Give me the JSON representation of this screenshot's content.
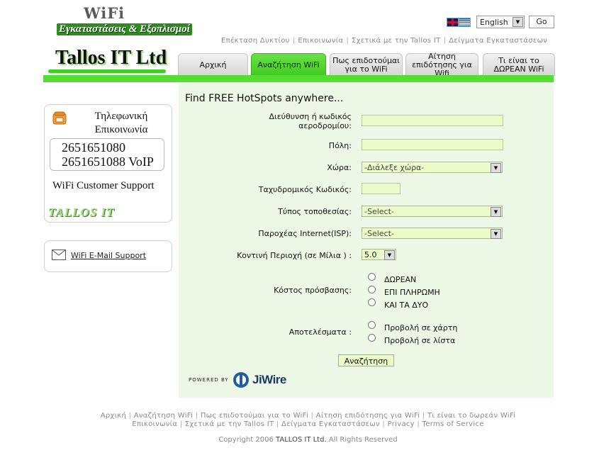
{
  "logo": {
    "wifi": "WiFi",
    "subtitle": "Εγκαταστάσεις & Εξοπλισμοί",
    "company": "Tallos IT Ltd"
  },
  "language": {
    "selected": "English",
    "go_label": "Go"
  },
  "top_links": [
    "Επέκταση Δυκτίου",
    "Επικοινωνία",
    "Σχετικά με την Tallos IT",
    "Δείγματα Εγκαταστάσεων"
  ],
  "tabs": [
    {
      "label": "Αρχική",
      "active": false
    },
    {
      "label": "Αναζήτηση  WiFi",
      "active": true
    },
    {
      "label": "Πως επιδοτούμαι για το WiFi",
      "active": false
    },
    {
      "label": "Αίτηση επιδότησης για Wifi",
      "active": false
    },
    {
      "label": "Τι είναι το ΔΩΡΕΑΝ WiFi",
      "active": false
    }
  ],
  "sidebar": {
    "phone_title_1": "Τηλεφωνική",
    "phone_title_2": "Επικοινωνία",
    "phone_1": "2651651080",
    "phone_2": "2651651088 VoIP",
    "support_label": "WiFi Customer Support",
    "tallos_logo": "TALLOS IT",
    "email_link": "WiFi E-Mail Support"
  },
  "form": {
    "title": "Find FREE HotSpots anywhere...",
    "address_label": "Διεύθυνση ή κωδικός αεροδρομίου:",
    "address_value": "",
    "city_label": "Πόλη:",
    "city_value": "",
    "country_label": "Χώρα:",
    "country_value": "-Διάλεξε χώρα-",
    "zip_label": "Ταχυδρομικός Κωδικός:",
    "zip_value": "",
    "location_type_label": "Τύπος τοποθεσίας:",
    "location_type_value": "-Select-",
    "isp_label": "Παροχέας Internet(ISP):",
    "isp_value": "-Select-",
    "radius_label": "Κοντινή Περιοχή (σε Μίλια ) :",
    "radius_value": "5.0",
    "cost_label": "Κόστος πρόσβασης:",
    "cost_options": [
      "ΔΩΡΕΑΝ",
      "ΕΠΙ ΠΛΗΡΩΜΗ",
      "ΚΑΙ ΤΑ ΔΥΟ"
    ],
    "results_label": "Αποτελέσματα :",
    "results_options": [
      "Προβολή σε χάρτη",
      "Προβολή σε λίστα"
    ],
    "submit_label": "Αναζήτηση",
    "powered_by": "POWERED BY",
    "jiwire": "JiWire"
  },
  "footer": {
    "row1": [
      "Αρχική",
      "Αναζήτηση WiFi",
      "Πως επιδοτούμαι για το WiFi",
      "Αίτηση επιδότησης για WiFi",
      "Τι είναι το δωρεάν WiFi"
    ],
    "row2": [
      "Επικοινωνία",
      "Σχετικά με την Tallos IT",
      "Δείγματα Εγκαταστάσεων",
      "Privacy",
      "Terms of Service"
    ],
    "copyright_prefix": "Copyright 2006",
    "copyright_company": "TALLOS IT Ltd.",
    "copyright_suffix": "All Rights Reserved"
  },
  "colors": {
    "accent_green": "#55dd33",
    "panel_bg": "#edf9e6",
    "field_bg": "#eafdc8"
  }
}
